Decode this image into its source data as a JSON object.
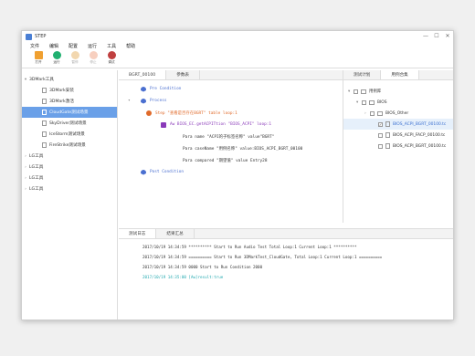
{
  "window": {
    "title": "STEP",
    "controls": [
      "—",
      "☐",
      "✕"
    ]
  },
  "menu": [
    "文件",
    "编辑",
    "配置",
    "运行",
    "工具",
    "帮助"
  ],
  "toolbar": [
    {
      "label": "打开",
      "color": "#f0a030",
      "disabled": false
    },
    {
      "label": "运行",
      "color": "#20b070",
      "disabled": false
    },
    {
      "label": "暂停",
      "color": "#e6b060",
      "disabled": true
    },
    {
      "label": "停止",
      "color": "#f0a080",
      "disabled": true
    },
    {
      "label": "调试",
      "color": "#c04040",
      "disabled": false
    }
  ],
  "left_tree": [
    {
      "label": "3DMark工具",
      "type": "group",
      "expanded": true
    },
    {
      "label": "3DMark安装",
      "type": "child"
    },
    {
      "label": "3DMark激活",
      "type": "child"
    },
    {
      "label": "CloudGate测试场景",
      "type": "child",
      "selected": true
    },
    {
      "label": "SkyDriver测试场景",
      "type": "child"
    },
    {
      "label": "IceStorm测试场景",
      "type": "child"
    },
    {
      "label": "FireStrike测试场景",
      "type": "child"
    },
    {
      "label": "LG工具",
      "type": "group",
      "expanded": false
    },
    {
      "label": "LG工具",
      "type": "group",
      "expanded": false
    },
    {
      "label": "LG工具",
      "type": "group",
      "expanded": false
    },
    {
      "label": "LG工具",
      "type": "group",
      "expanded": false
    }
  ],
  "editor": {
    "tabs": [
      "BGRT_00100",
      "参数表"
    ],
    "steps": [
      {
        "text": "Pre Condition",
        "indent": 0,
        "color": "#4a6fd0",
        "icon": "blue"
      },
      {
        "text": "Process",
        "indent": 0,
        "color": "#4a6fd0",
        "icon": "blue"
      },
      {
        "text": "Step \"查看是否存在BGRT\" table loop:1",
        "indent": 1,
        "color": "#e06a2a",
        "icon": "orange"
      },
      {
        "text": "Aw BIOS_EC.getACPITtion \"BIOS_ACPI\" loop:1",
        "indent": 2,
        "color": "#8a3ab9",
        "icon": "purple"
      },
      {
        "text": "Para name \"ACPI的子标签名称\" value\"BGRT\"",
        "indent": 3,
        "color": "#333333",
        "icon": "none"
      },
      {
        "text": "Para caseName \"用例名称\" value:BIOS_ACPI_BGRT_00100",
        "indent": 3,
        "color": "#333333",
        "icon": "none"
      },
      {
        "text": "Para compared \"期望值\" value Entry28",
        "indent": 3,
        "color": "#333333",
        "icon": "none"
      },
      {
        "text": "Post Condition",
        "indent": 0,
        "color": "#4a6fd0",
        "icon": "blue"
      }
    ]
  },
  "right_panel": {
    "tabs": [
      "测试计划",
      "用例合集"
    ],
    "tree": [
      {
        "label": "用例库",
        "indent": 0,
        "expanded": true,
        "kind": "folder"
      },
      {
        "label": "BIOS",
        "indent": 1,
        "expanded": true,
        "kind": "folder"
      },
      {
        "label": "BIOS_Other",
        "indent": 2,
        "expanded": false,
        "kind": "folder"
      },
      {
        "label": "BIOS_ACPI_BGRT_00100.tc",
        "indent": 3,
        "checked": true,
        "kind": "file",
        "highlight": true
      },
      {
        "label": "BIOS_ACPI_FACP_00100.tc",
        "indent": 3,
        "checked": false,
        "kind": "file"
      },
      {
        "label": "BIOS_ACPI_BGRT_00100.tc",
        "indent": 3,
        "checked": false,
        "kind": "file"
      }
    ]
  },
  "log": {
    "tabs": [
      "测试日志",
      "结果汇总"
    ],
    "lines": [
      {
        "text": "2017/10/19 14:34:59 ********** Start to Run Audio Test Total Loop:1 Current Loop:1 **********",
        "color": "#333333"
      },
      {
        "text": "2017/10/19 14:34:59 ========== Start to Run 3DMarkTest_CloudGate, Total Loop:1 Current Loop:1 ==========",
        "color": "#333333"
      },
      {
        "text": "2017/10/19 14:34:59 0000 Start to Run Condition 2000",
        "color": "#333333"
      },
      {
        "text": "2017/10/19 14:35:00 [Aw]result:true",
        "color": "#22a9b0"
      }
    ]
  }
}
